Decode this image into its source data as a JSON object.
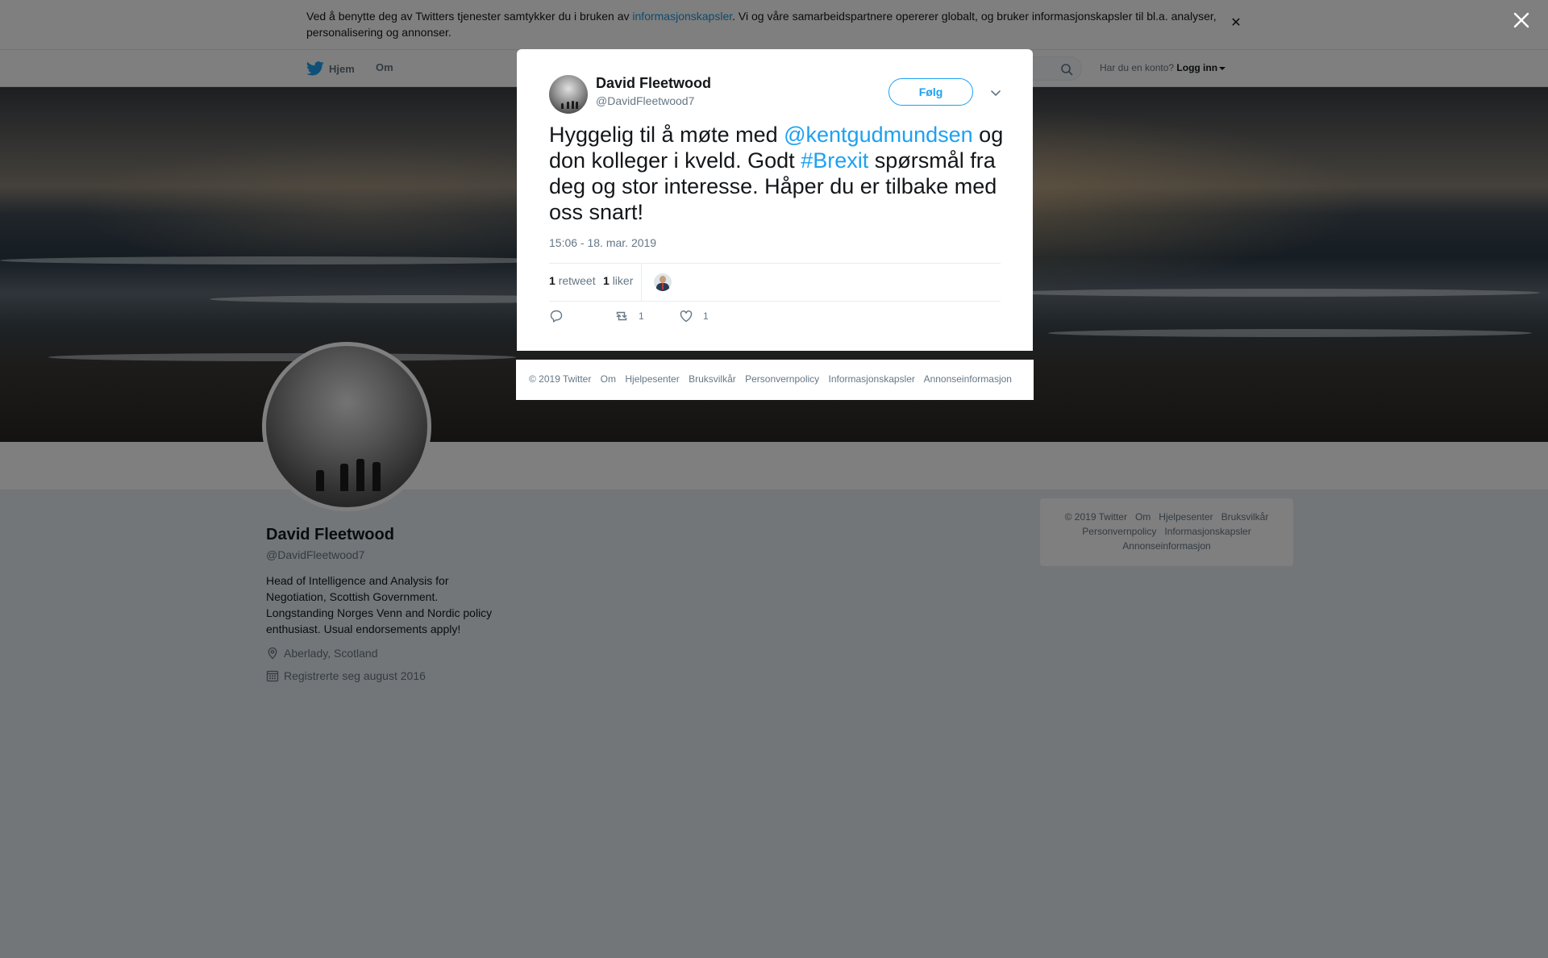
{
  "colors": {
    "accent": "#1da1f2",
    "link": "#1b95e0",
    "text": "#14171a",
    "muted": "#657786",
    "overlay": "rgba(0,0,0,0.5)"
  },
  "cookie_bar": {
    "text_before": "Ved å benytte deg av Twitters tjenester samtykker du i bruken av ",
    "link": "informasjonskapsler",
    "text_after": ". Vi og våre samarbeidspartnere opererer globalt, og bruker informasjonskapsler til bl.a. analyser, personalisering og annonser.",
    "close_icon": "close-icon"
  },
  "nav": {
    "home_label": "Hjem",
    "about_label": "Om",
    "login_prompt": "Har du en konto?",
    "login_label": "Logg inn",
    "logo_icon": "twitter-bird-icon",
    "search_icon": "search-icon"
  },
  "profile": {
    "name": "David Fleetwood",
    "handle": "@DavidFleetwood7",
    "bio": "Head of Intelligence and Analysis for Negotiation, Scottish Government. Longstanding Norges Venn and Nordic policy enthusiast. Usual endorsements apply!",
    "location": "Aberlady, Scotland",
    "joined": "Registrerte seg august 2016"
  },
  "tweet": {
    "author_name": "David Fleetwood",
    "author_handle": "@DavidFleetwood7",
    "follow_label": "Følg",
    "text_part1": "Hyggelig til å møte med ",
    "mention": "@kentgudmundsen",
    "text_part2": " og don kolleger i kveld. Godt ",
    "hashtag": "#Brexit",
    "text_part3": " spørsmål fra deg og stor interesse. Håper du er tilbake med oss snart!",
    "timestamp": "15:06 - 18. mar. 2019",
    "retweet_count": "1",
    "retweet_label": "retweet",
    "like_count": "1",
    "like_label": "liker",
    "action_retweet_count": "1",
    "action_like_count": "1"
  },
  "footer_links": [
    "© 2019 Twitter",
    "Om",
    "Hjelpesenter",
    "Bruksvilkår",
    "Personvernpolicy",
    "Informasjonskapsler",
    "Annonseinformasjon"
  ]
}
